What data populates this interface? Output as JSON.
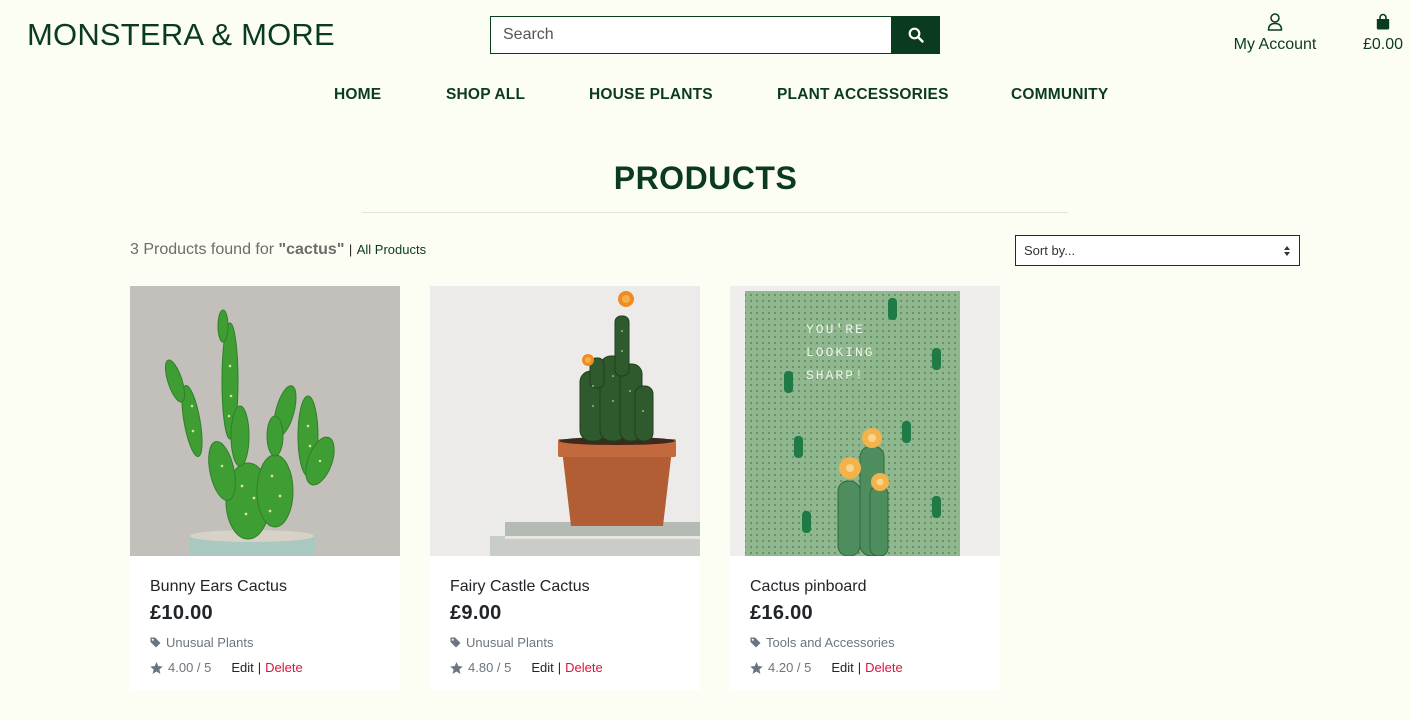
{
  "header": {
    "logo": "MONSTERA & MORE",
    "search_placeholder": "Search",
    "account_label": "My Account",
    "bag_total": "£0.00"
  },
  "nav": {
    "items": [
      "HOME",
      "SHOP ALL",
      "HOUSE PLANTS",
      "PLANT ACCESSORIES",
      "COMMUNITY"
    ]
  },
  "page": {
    "title": "PRODUCTS",
    "results_prefix": "3 Products found for",
    "query": "\"cactus\"",
    "separator": "|",
    "all_products_link": "All Products",
    "sort_label": "Sort by..."
  },
  "products": [
    {
      "name": "Bunny Ears Cactus",
      "price": "£10.00",
      "category": "Unusual Plants",
      "rating": "4.00 / 5",
      "edit": "Edit",
      "pipe": "|",
      "delete": "Delete"
    },
    {
      "name": "Fairy Castle Cactus",
      "price": "£9.00",
      "category": "Unusual Plants",
      "rating": "4.80 / 5",
      "edit": "Edit",
      "pipe": "|",
      "delete": "Delete"
    },
    {
      "name": "Cactus pinboard",
      "price": "£16.00",
      "category": "Tools and Accessories",
      "rating": "4.20 / 5",
      "edit": "Edit",
      "pipe": "|",
      "delete": "Delete"
    }
  ],
  "pinboard_text": [
    "YOU'RE",
    "LOOKING",
    "SHARP!"
  ],
  "colors": {
    "brand": "#0b3b1e",
    "background": "#fdfef3",
    "delete": "#dc143c",
    "muted": "#6c757d"
  }
}
